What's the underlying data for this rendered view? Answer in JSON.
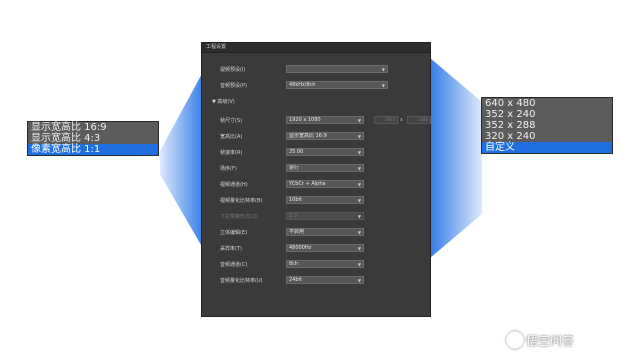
{
  "dialog": {
    "title": "工程设置",
    "rows": {
      "video_preset": {
        "label": "视频预设(I)",
        "value": ""
      },
      "audio_preset": {
        "label": "音频预设(P)",
        "value": "48kHz/8ch"
      },
      "frame_size": {
        "label": "帧尺寸(S)",
        "value": "1920 x 1080",
        "custom_w": "1920",
        "sep": "x",
        "custom_h": "1080"
      },
      "aspect": {
        "label": "宽高比(A)",
        "value": "显示宽高比 16:9"
      },
      "frame_rate": {
        "label": "帧速率(R)",
        "value": "25.00"
      },
      "field_order": {
        "label": "场序(F)",
        "value": "逐行"
      },
      "video_channel": {
        "label": "视频通道(H)",
        "value": "YCbCr + Alpha"
      },
      "video_bitdepth": {
        "label": "视频量化比特率(B)",
        "value": "10bit"
      },
      "pulldown": {
        "label": "下拉变换形式(O)",
        "value": "2:3"
      },
      "stereo": {
        "label": "立体编辑(E)",
        "value": "不启用"
      },
      "sample_rate": {
        "label": "采样率(T)",
        "value": "48000Hz"
      },
      "audio_channel": {
        "label": "音频通道(C)",
        "value": "8ch"
      },
      "audio_bitdepth": {
        "label": "音频量化比特率(U)",
        "value": "24bit"
      }
    },
    "advanced_label": "▼ 高级(V)"
  },
  "left_dropdown": {
    "options": [
      "显示宽高比 16:9",
      "显示宽高比 4:3",
      "像素宽高比 1:1"
    ],
    "selected_index": 2
  },
  "right_dropdown": {
    "options": [
      "640 x 480",
      "352 x 240",
      "352 x 288",
      "320 x 240",
      "自定义"
    ],
    "selected_index": 4
  },
  "watermark": {
    "text": "悟空问答"
  },
  "colors": {
    "accent": "#1f6fe0",
    "dialog_bg": "#3a3a3a"
  }
}
